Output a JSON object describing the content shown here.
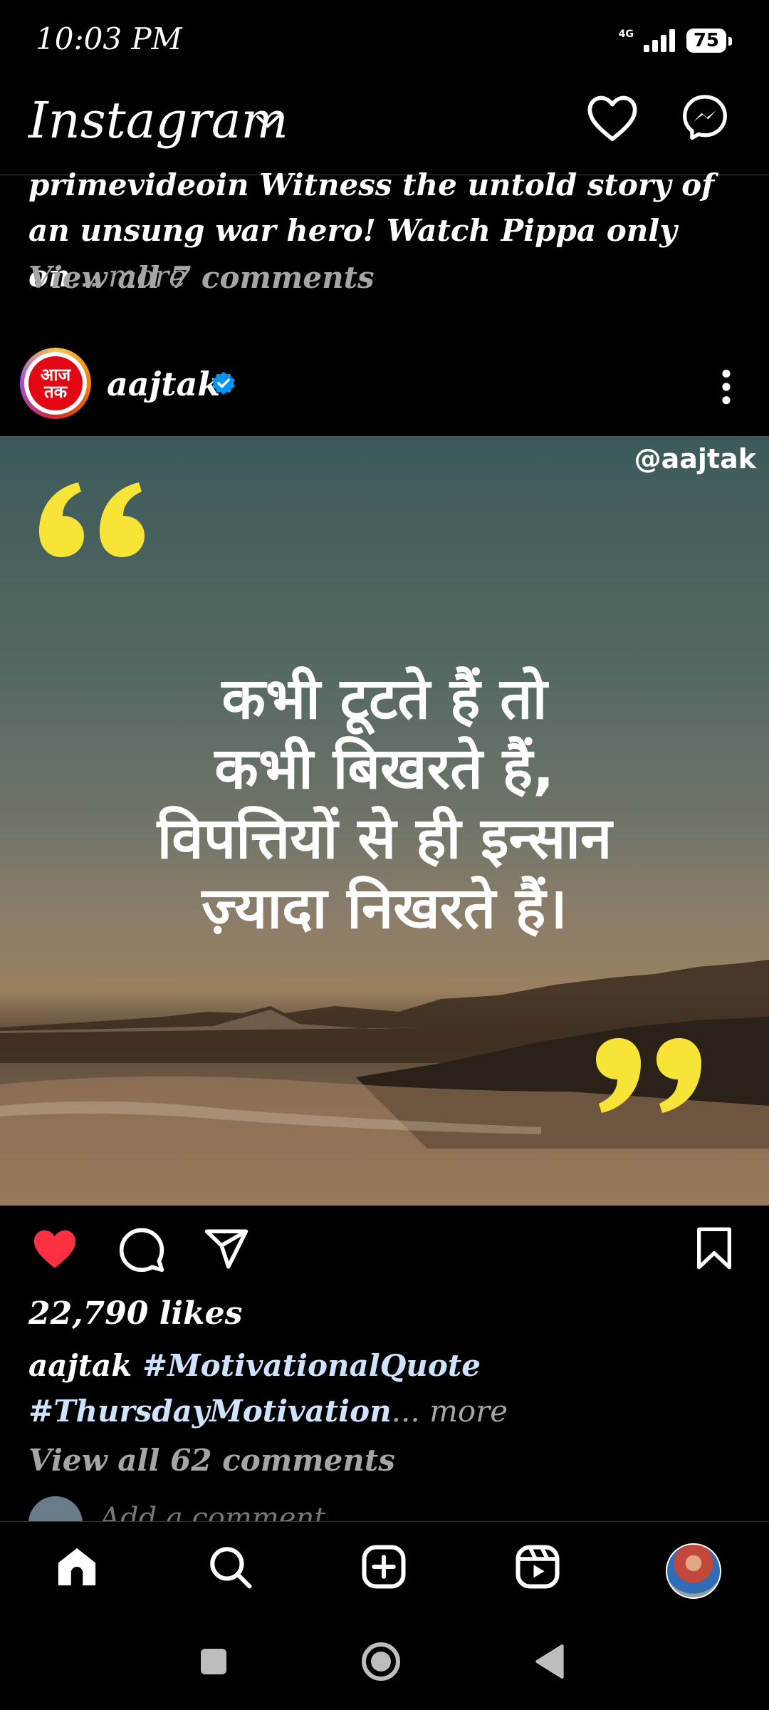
{
  "status_bar": {
    "time": "10:03 PM",
    "network": "4G",
    "battery": "75"
  },
  "header": {
    "app_name": "Instagram"
  },
  "previous_post": {
    "caption_user": "primevideoin",
    "caption_text": "Witness the untold story of an unsung war hero! Watch Pippa only on",
    "more_label": "... more",
    "view_comments": "View all 7 comments"
  },
  "post": {
    "username": "aajtak",
    "avatar_text": "आज तक",
    "watermark": "@aajtak",
    "quote_lines": [
      "कभी टूटते हैं तो",
      "कभी बिखरते हैं,",
      "विपत्तियों से ही इन्सान",
      "ज़्यादा निखरते हैं।"
    ],
    "likes": "22,790 likes",
    "caption_user": "aajtak",
    "hashtag_1": "#MotivationalQuote",
    "hashtag_2": "#ThursdayMotivation",
    "more_label": "... more",
    "view_comments": "View all 62 comments",
    "add_comment": "Add a comment..."
  },
  "colors": {
    "like_red": "#ff3040",
    "verified_blue": "#0095f6",
    "quote_yellow": "#f7e436"
  }
}
